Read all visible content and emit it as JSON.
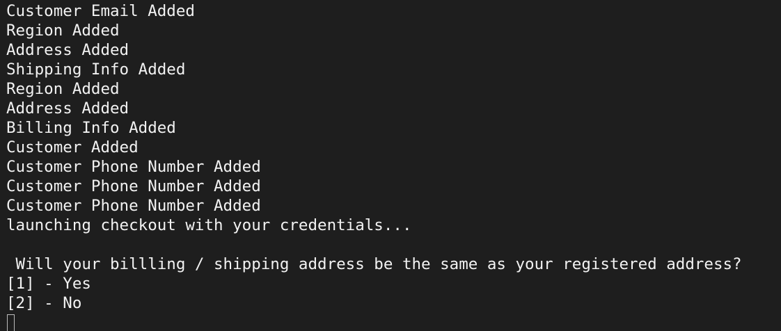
{
  "terminal": {
    "lines": [
      "Customer Email Added",
      "Region Added",
      "Address Added",
      "Shipping Info Added",
      "Region Added",
      "Address Added",
      "Billing Info Added",
      "Customer Added",
      "Customer Phone Number Added",
      "Customer Phone Number Added",
      "Customer Phone Number Added",
      "launching checkout with your credentials...",
      "",
      " Will your billling / shipping address be the same as your registered address?",
      "[1] - Yes",
      "[2] - No"
    ]
  }
}
